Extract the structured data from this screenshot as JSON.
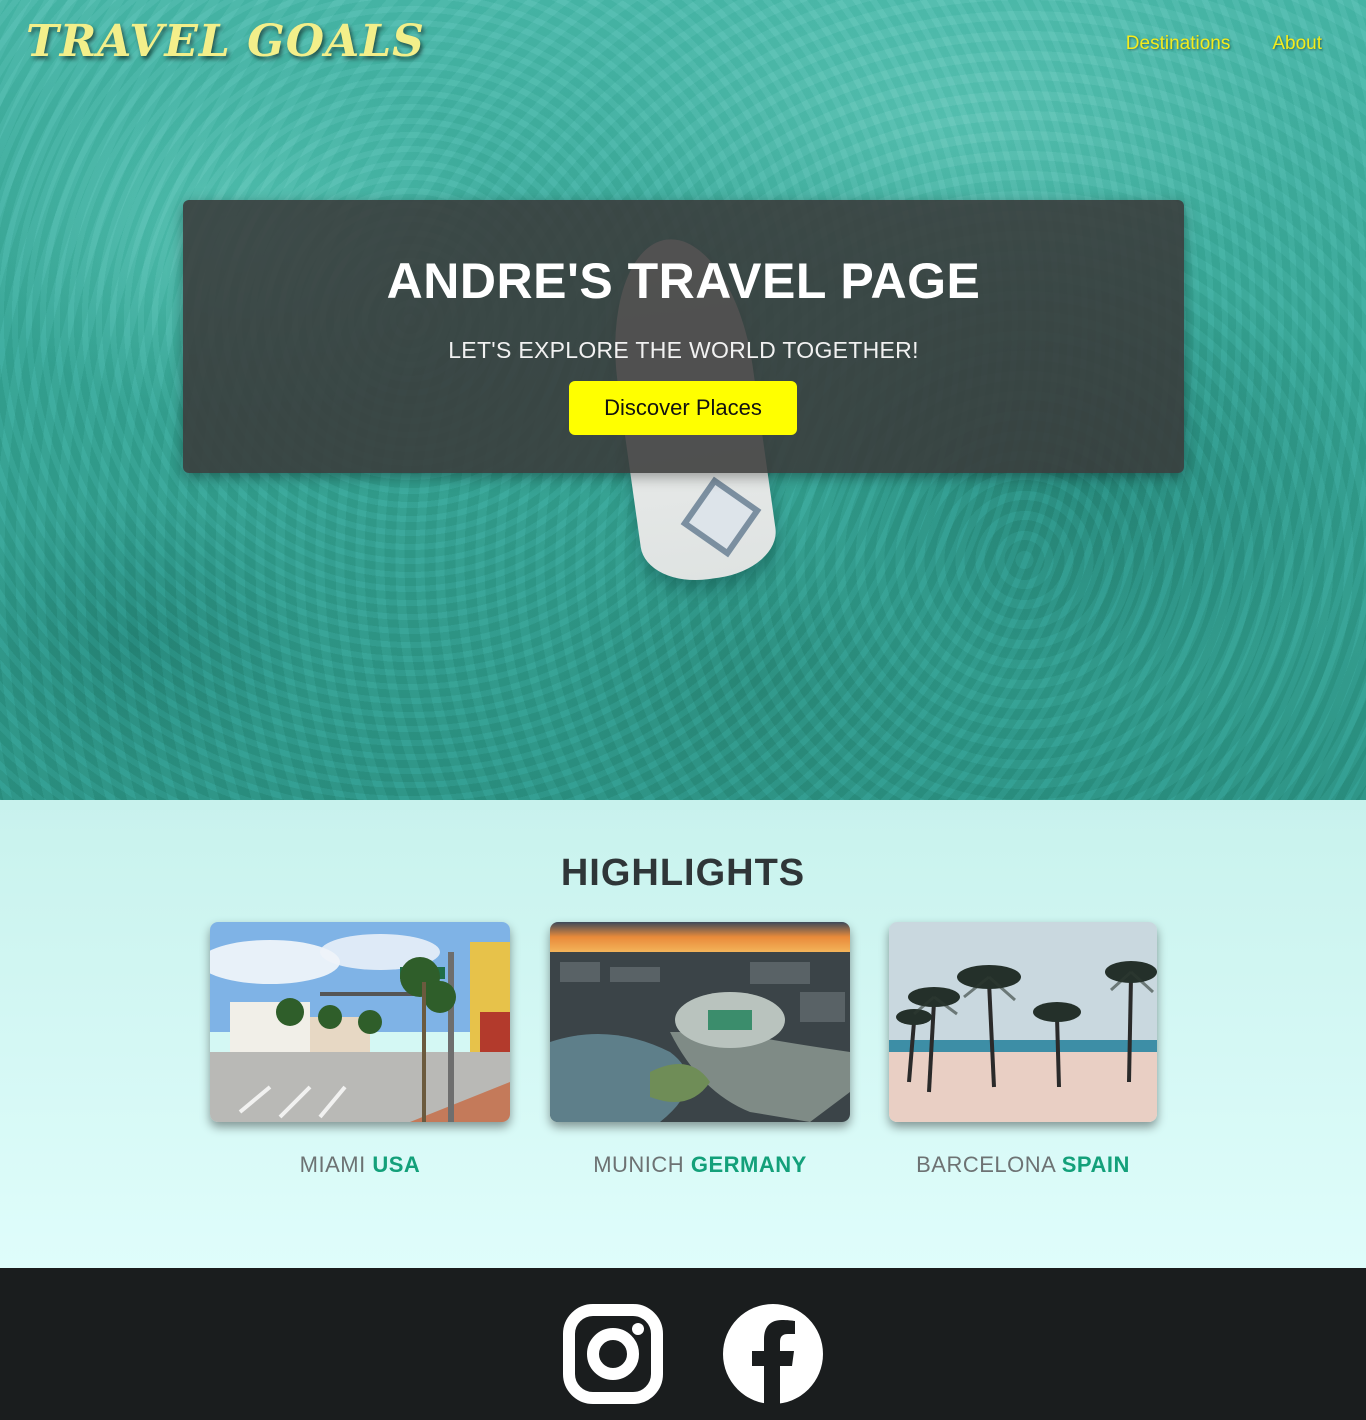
{
  "header": {
    "logo": "TRAVEL GOALS",
    "nav": [
      {
        "label": "Destinations"
      },
      {
        "label": "About"
      }
    ]
  },
  "hero": {
    "title": "ANDRE'S TRAVEL PAGE",
    "subtitle": "LET'S EXPLORE THE WORLD TOGETHER!",
    "button_label": "Discover Places"
  },
  "highlights": {
    "title": "HIGHLIGHTS",
    "items": [
      {
        "city": "MIAMI",
        "country": "USA",
        "image": "miami-street-photo"
      },
      {
        "city": "MUNICH",
        "country": "GERMANY",
        "image": "munich-stadium-photo"
      },
      {
        "city": "BARCELONA",
        "country": "SPAIN",
        "image": "barcelona-beach-photo"
      }
    ]
  },
  "footer": {
    "icons": [
      "instagram-icon",
      "facebook-icon"
    ]
  },
  "colors": {
    "accent_yellow": "#ffff00",
    "nav_yellow": "#f4ec1c",
    "country_green": "#13a07a",
    "footer_bg": "#1a1d1e"
  }
}
